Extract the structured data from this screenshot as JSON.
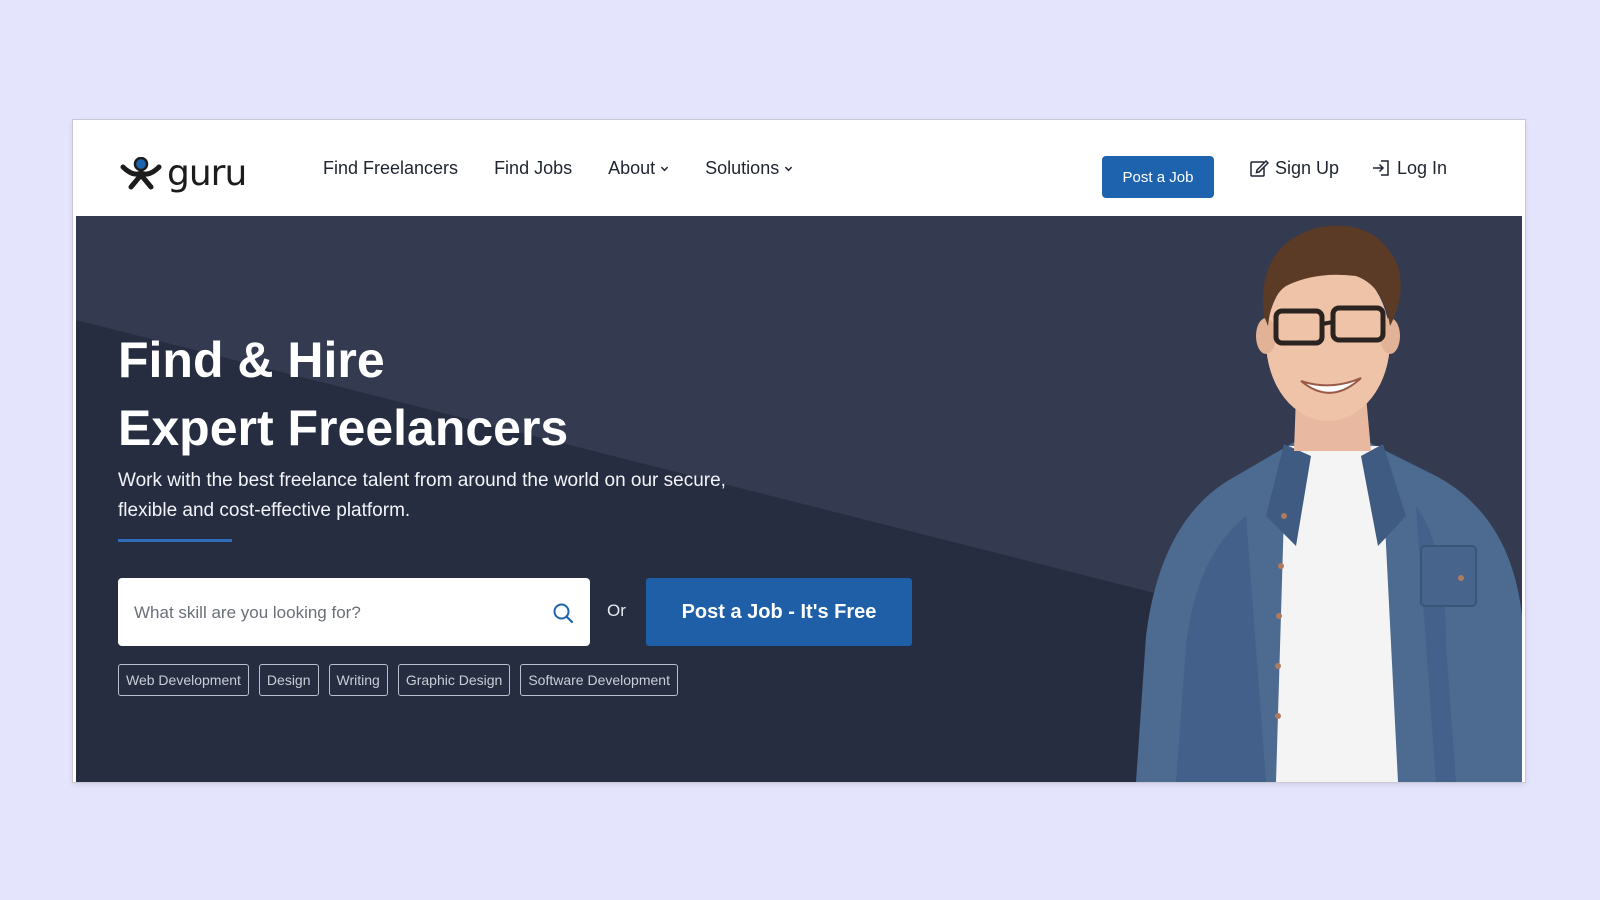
{
  "nav": {
    "logo_text": "guru",
    "links": [
      {
        "label": "Find Freelancers",
        "dropdown": false
      },
      {
        "label": "Find Jobs",
        "dropdown": false
      },
      {
        "label": "About",
        "dropdown": true
      },
      {
        "label": "Solutions",
        "dropdown": true
      }
    ],
    "post_job_label": "Post a Job",
    "signup_label": "Sign Up",
    "login_label": "Log In"
  },
  "hero": {
    "title_line1": "Find & Hire",
    "title_line2": "Expert Freelancers",
    "subtitle_line1": "Work with the best freelance talent from around the world on our secure,",
    "subtitle_line2": "flexible and cost-effective platform.",
    "search_placeholder": "What skill are you looking for?",
    "or_text": "Or",
    "cta_label": "Post a Job - It's Free",
    "tags": [
      "Web Development",
      "Design",
      "Writing",
      "Graphic Design",
      "Software Development"
    ]
  },
  "icons": {
    "logo": "guru-logo-icon",
    "signup": "edit-icon",
    "login": "login-icon",
    "search": "search-icon",
    "dropdown": "chevron-down-icon"
  },
  "colors": {
    "page_bg": "#e5e4fd",
    "hero_bg": "#2e3548",
    "primary_button": "#1e63ad",
    "accent_line": "#2f6dba"
  }
}
